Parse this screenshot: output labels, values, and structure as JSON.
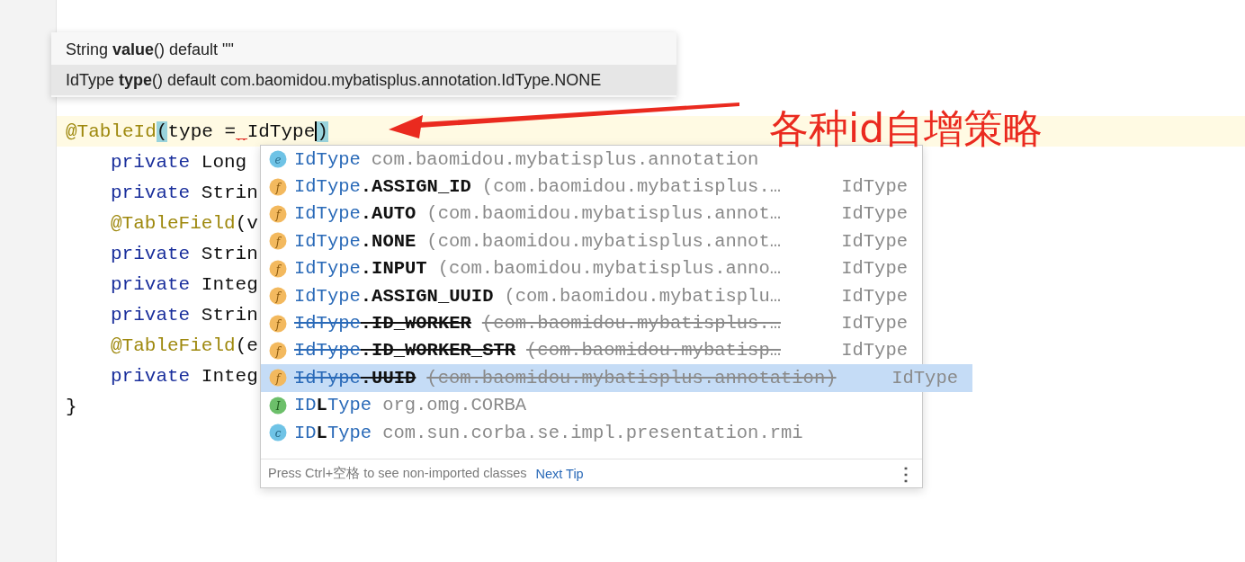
{
  "editor": {
    "lines": [
      {
        "current": true,
        "tokens": [
          {
            "kind": "annotation",
            "text": "@TableId"
          },
          {
            "kind": "brace",
            "text": "("
          },
          {
            "kind": "plain",
            "text": "type ="
          },
          {
            "kind": "error"
          },
          {
            "kind": "plain",
            "text": "IdType"
          },
          {
            "kind": "caret"
          },
          {
            "kind": "brace",
            "text": ")"
          }
        ]
      },
      {
        "current": false,
        "tokens": [
          {
            "kind": "indent"
          },
          {
            "kind": "keyword",
            "text": "private"
          },
          {
            "kind": "plain",
            "text": "Long"
          }
        ]
      },
      {
        "current": false,
        "tokens": [
          {
            "kind": "indent"
          },
          {
            "kind": "keyword",
            "text": "private"
          },
          {
            "kind": "plain",
            "text": "Strin"
          }
        ]
      },
      {
        "current": false,
        "tokens": [
          {
            "kind": "indent"
          },
          {
            "kind": "annotation",
            "text": "@TableField"
          },
          {
            "kind": "plain",
            "text": "(v"
          }
        ]
      },
      {
        "current": false,
        "tokens": [
          {
            "kind": "indent"
          },
          {
            "kind": "keyword",
            "text": "private"
          },
          {
            "kind": "plain",
            "text": "Strin"
          }
        ]
      },
      {
        "current": false,
        "tokens": [
          {
            "kind": "indent"
          },
          {
            "kind": "keyword",
            "text": "private"
          },
          {
            "kind": "plain",
            "text": "Integ"
          }
        ]
      },
      {
        "current": false,
        "tokens": [
          {
            "kind": "indent"
          },
          {
            "kind": "keyword",
            "text": "private"
          },
          {
            "kind": "plain",
            "text": "Strin"
          }
        ]
      },
      {
        "current": false,
        "tokens": [
          {
            "kind": "indent"
          },
          {
            "kind": "annotation",
            "text": "@TableField"
          },
          {
            "kind": "plain",
            "text": "(e"
          }
        ]
      },
      {
        "current": false,
        "tokens": [
          {
            "kind": "indent"
          },
          {
            "kind": "keyword",
            "text": "private"
          },
          {
            "kind": "plain",
            "text": "Integ"
          }
        ]
      },
      {
        "current": false,
        "tokens": [
          {
            "kind": "plain",
            "text": "}"
          }
        ]
      }
    ]
  },
  "parameter_info": {
    "rows": [
      {
        "text": "String **value**() default \"\"",
        "selected": false
      },
      {
        "text": "IdType **type**() default com.baomidou.mybatisplus.annotation.IdType.NONE",
        "selected": true
      }
    ]
  },
  "completion": {
    "items": [
      {
        "kind": "enum",
        "icon": "e",
        "segments": [
          {
            "text": "IdType",
            "match": true
          }
        ],
        "detail": "com.baomidou.mybatisplus.annotation",
        "deprecated": false,
        "selected": false
      },
      {
        "kind": "field",
        "icon": "f",
        "segments": [
          {
            "text": "IdType",
            "match": true
          },
          {
            "text": ".ASSIGN_ID",
            "match": false
          }
        ],
        "detail": "(com.baomidou.mybatisplus.…",
        "type": "IdType",
        "deprecated": false,
        "selected": false
      },
      {
        "kind": "field",
        "icon": "f",
        "segments": [
          {
            "text": "IdType",
            "match": true
          },
          {
            "text": ".AUTO",
            "match": false
          }
        ],
        "detail": "(com.baomidou.mybatisplus.annot…",
        "type": "IdType",
        "deprecated": false,
        "selected": false
      },
      {
        "kind": "field",
        "icon": "f",
        "segments": [
          {
            "text": "IdType",
            "match": true
          },
          {
            "text": ".NONE",
            "match": false
          }
        ],
        "detail": "(com.baomidou.mybatisplus.annot…",
        "type": "IdType",
        "deprecated": false,
        "selected": false
      },
      {
        "kind": "field",
        "icon": "f",
        "segments": [
          {
            "text": "IdType",
            "match": true
          },
          {
            "text": ".INPUT",
            "match": false
          }
        ],
        "detail": "(com.baomidou.mybatisplus.anno…",
        "type": "IdType",
        "deprecated": false,
        "selected": false
      },
      {
        "kind": "field",
        "icon": "f",
        "segments": [
          {
            "text": "IdType",
            "match": true
          },
          {
            "text": ".ASSIGN_UUID",
            "match": false
          }
        ],
        "detail": "(com.baomidou.mybatisplu…",
        "type": "IdType",
        "deprecated": false,
        "selected": false
      },
      {
        "kind": "field",
        "icon": "f",
        "segments": [
          {
            "text": "IdType",
            "match": true
          },
          {
            "text": ".ID_WORKER",
            "match": false
          }
        ],
        "detail": "(com.baomidou.mybatisplus.…",
        "type": "IdType",
        "deprecated": true,
        "selected": false
      },
      {
        "kind": "field",
        "icon": "f",
        "segments": [
          {
            "text": "IdType",
            "match": true
          },
          {
            "text": ".ID_WORKER_STR",
            "match": false
          }
        ],
        "detail": "(com.baomidou.mybatisp…",
        "type": "IdType",
        "deprecated": true,
        "selected": false
      },
      {
        "kind": "field",
        "icon": "f",
        "segments": [
          {
            "text": "IdType",
            "match": true
          },
          {
            "text": ".UUID",
            "match": false
          }
        ],
        "detail": "(com.baomidou.mybatisplus.annotation)",
        "type": "IdType",
        "deprecated": true,
        "selected": true
      },
      {
        "kind": "interface",
        "icon": "I",
        "segments": [
          {
            "text": "ID",
            "match": true
          },
          {
            "text": "L",
            "match": false
          },
          {
            "text": "Type",
            "match": true
          }
        ],
        "detail": "org.omg.CORBA",
        "deprecated": false,
        "selected": false
      },
      {
        "kind": "class",
        "icon": "c",
        "segments": [
          {
            "text": "ID",
            "match": true
          },
          {
            "text": "L",
            "match": false
          },
          {
            "text": "Type",
            "match": true
          }
        ],
        "detail": "com.sun.corba.se.impl.presentation.rmi",
        "deprecated": false,
        "selected": false
      }
    ],
    "footer": {
      "hint": "Press Ctrl+空格 to see non-imported classes",
      "link": "Next Tip",
      "menu": "⋮"
    }
  },
  "annotation": {
    "text": "各种id自增策略"
  }
}
